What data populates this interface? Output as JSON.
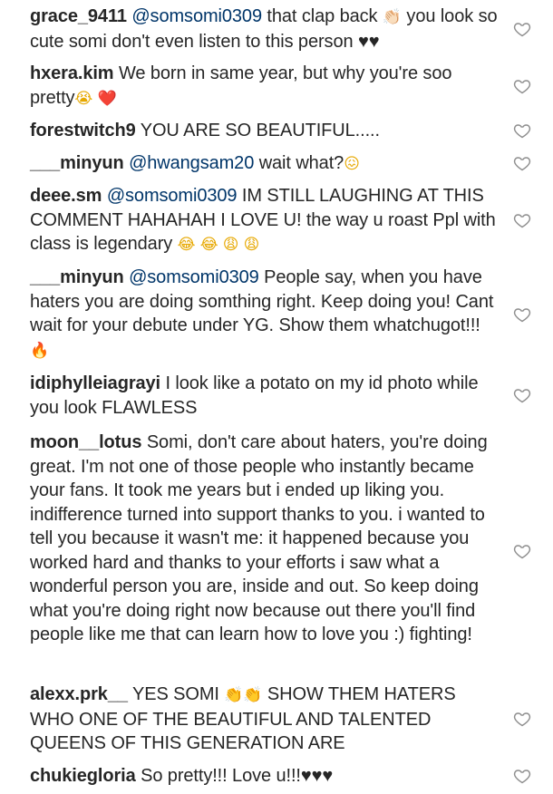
{
  "comments": [
    {
      "username": "grace_9411",
      "mention": "@somsomi0309",
      "text_before_emoji": " that clap back ",
      "emoji": "👏🏻",
      "text_after_emoji": " you look so cute somi don't even listen to this person ♥♥"
    },
    {
      "username": "hxera.kim",
      "text": " We born in same year, but why you're soo pretty",
      "emoji1": "😭",
      "emoji2": "❤️"
    },
    {
      "username": "forestwitch9",
      "text": " YOU ARE SO BEAUTIFUL....."
    },
    {
      "username": "___minyun",
      "mention": "@hwangsam20",
      "text": " wait what?",
      "emoji": "😖"
    },
    {
      "username": "deee.sm",
      "mention": "@somsomi0309",
      "text": " IM STILL LAUGHING AT THIS COMMENT HAHAHAH I LOVE U! the way u roast Ppl with class is legendary ",
      "emojis": "😂 😂 😩 😩"
    },
    {
      "username": "___minyun",
      "mention": "@somsomi0309",
      "text": " People say, when you have haters you are doing somthing right. Keep doing you! Cant wait for your debute under YG. Show them whatchugot!!! ",
      "emoji": "🔥"
    },
    {
      "username": "idiphylleiagrayi",
      "text": " I look like a potato on my id photo while you look FLAWLESS"
    },
    {
      "username": "moon__lotus",
      "text": " Somi, don't care about haters, you're doing great. I'm not one of those people who instantly became your fans. It took me years but i ended up liking you. indifference turned into support thanks to you. i wanted to tell you because it wasn't me: it happened because you worked hard and thanks to your efforts i saw what a wonderful person you are, inside and out. So keep doing what you're doing right now because out there you'll find people like me that can learn how to love you :) fighting!"
    },
    {
      "username": "alexx.prk__",
      "text_before_emoji": " YES SOMI ",
      "emoji": "👏👏",
      "text_after_emoji": " SHOW THEM HATERS WHO ONE OF THE BEAUTIFUL AND TALENTED QUEENS OF THIS GENERATION ARE"
    },
    {
      "username": "chukiegloria",
      "text": " So pretty!!! Love u!!!♥♥♥"
    }
  ],
  "icons": {
    "like": "heart-outline-icon"
  },
  "colors": {
    "text": "#262626",
    "mention": "#003569",
    "icon_stroke": "#8e8e8e"
  }
}
